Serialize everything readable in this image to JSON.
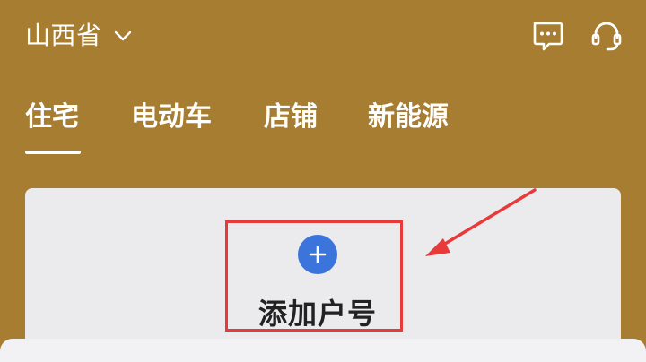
{
  "header": {
    "region": "山西省",
    "icons": {
      "region_chevron": "chevron-down-icon",
      "message": "message-dots-icon",
      "support": "headset-icon"
    }
  },
  "tabs": [
    {
      "label": "住宅",
      "active": true
    },
    {
      "label": "电动车",
      "active": false
    },
    {
      "label": "店铺",
      "active": false
    },
    {
      "label": "新能源",
      "active": false
    }
  ],
  "card": {
    "add_account_label": "添加户号",
    "plus_icon": "plus-circle-icon"
  },
  "colors": {
    "header_bg": "#a77d31",
    "accent_blue": "#3b74db",
    "annotation_red": "#e83a3a",
    "card_bg": "#ebebee"
  }
}
